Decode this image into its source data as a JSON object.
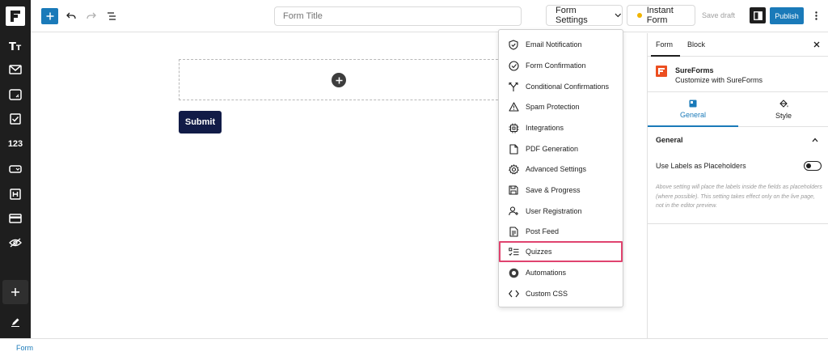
{
  "topbar": {
    "form_title_placeholder": "Form Title",
    "form_settings_label": "Form Settings",
    "instant_form_label": "Instant Form",
    "save_draft_label": "Save draft",
    "publish_label": "Publish"
  },
  "sidebar": {
    "numbers_label": "123"
  },
  "canvas": {
    "submit_label": "Submit"
  },
  "settings_menu": {
    "items": [
      {
        "label": "Email Notification",
        "icon": "shield-icon"
      },
      {
        "label": "Form Confirmation",
        "icon": "check-circle-icon"
      },
      {
        "label": "Conditional Confirmations",
        "icon": "branch-icon"
      },
      {
        "label": "Spam Protection",
        "icon": "warning-icon"
      },
      {
        "label": "Integrations",
        "icon": "chip-icon"
      },
      {
        "label": "PDF Generation",
        "icon": "document-icon"
      },
      {
        "label": "Advanced Settings",
        "icon": "gear-icon"
      },
      {
        "label": "Save & Progress",
        "icon": "save-icon"
      },
      {
        "label": "User Registration",
        "icon": "user-add-icon"
      },
      {
        "label": "Post Feed",
        "icon": "file-text-icon"
      },
      {
        "label": "Quizzes",
        "icon": "quiz-list-icon",
        "highlighted": true
      },
      {
        "label": "Automations",
        "icon": "automation-icon"
      },
      {
        "label": "Custom CSS",
        "icon": "code-icon"
      }
    ]
  },
  "inspector": {
    "tab_form": "Form",
    "tab_block": "Block",
    "plugin_name": "SureForms",
    "plugin_desc": "Customize with SureForms",
    "panel_tab_general": "General",
    "panel_tab_style": "Style",
    "section_title": "General",
    "placeholder_label": "Use Labels as Placeholders",
    "placeholder_enabled": false,
    "help_text": "Above setting will place the labels inside the fields as placeholders (where possible). This setting takes effect only on the live page, not in the editor preview."
  },
  "footer": {
    "breadcrumb": "Form"
  },
  "colors": {
    "accent": "#1a7ab9",
    "submit": "#111b47",
    "highlight": "#e0436f",
    "brand": "#ec4e20",
    "status_dot": "#f0b400"
  }
}
